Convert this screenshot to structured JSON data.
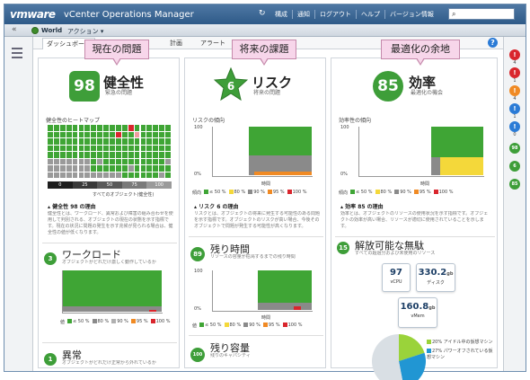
{
  "topbar": {
    "logo": "vmware",
    "app_title": "vCenter Operations Manager",
    "nav": [
      "構成",
      "通知",
      "ログアウト",
      "ヘルプ",
      "バージョン情報"
    ],
    "search_icon": "search-icon"
  },
  "toolbar": {
    "world": "World",
    "actions": "アクション",
    "dbl": "«"
  },
  "tabs": [
    "ダッシュボード",
    "計画",
    "アラート"
  ],
  "callouts": [
    "現在の問題",
    "将来の課題",
    "最適化の余地"
  ],
  "health": {
    "score": "98",
    "title": "健全性",
    "subtitle": "緊急の問題",
    "heatmap_label": "健全性のヒートマップ",
    "scale": [
      "0",
      "25",
      "50",
      "75",
      "100"
    ],
    "scale_caption": "すべてのオブジェクト(健全性)",
    "reason_title": "健全性 98 の理由",
    "reason_desc": "健全性とは、ワークロード、異常および障害の組み合わせを使用して判別される、オブジェクトの現在の状態を示す指標です。現在の状況に問題の発生を示す兆候が見られる場合は、健全性の値が低くなります。"
  },
  "workload": {
    "title": "ワークロード",
    "desc": "オブジェクトがどれだけ激しく動作しているか",
    "legend": [
      "≤ 50 %",
      "80 %",
      "90 %",
      "95 %",
      "100 %"
    ],
    "legend_prefix": "値"
  },
  "anomaly": {
    "title": "異常",
    "desc": "オブジェクトがどれだけ正常から外れているか"
  },
  "risk": {
    "score": "6",
    "title": "リスク",
    "subtitle": "将来の問題",
    "trend_label": "リスクの傾向",
    "y_top": "100",
    "y_bottom": "0%",
    "x_labels": [
      "",
      "時間",
      ""
    ],
    "legend": [
      "≤ 50 %",
      "80 %",
      "90 %",
      "95 %",
      "100 %"
    ],
    "legend_prefix": "傾向",
    "reason_title": "リスク 6 の理由",
    "reason_desc": "リスクとは、オブジェクトの将来に発生する可能性のある問題を示す指標です。オブジェクトのリスクが高い場合、今後そのオブジェクトで問題が発生する可能性が高くなります。"
  },
  "time_remaining": {
    "score": "89",
    "title": "残り時間",
    "desc": "リソースの容量が枯渇するまでの残り時間",
    "legend": [
      "≤ 50 %",
      "80 %",
      "90 %",
      "95 %",
      "100 %"
    ],
    "legend_prefix": "値",
    "x_labels": [
      "",
      "時間",
      ""
    ],
    "y_top": "100",
    "y_bottom": "0%"
  },
  "capacity_remaining": {
    "score": "100",
    "title": "残り容量",
    "desc": "残りのキャパシティ"
  },
  "efficiency": {
    "score": "85",
    "title": "効率",
    "subtitle": "最適化の機会",
    "trend_label": "効率性の傾向",
    "y_top": "100",
    "y_bottom": "0%",
    "x_labels": [
      "",
      "時間",
      ""
    ],
    "legend": [
      "≤ 50 %",
      "80 %",
      "90 %",
      "95 %",
      "100 %"
    ],
    "legend_prefix": "傾向",
    "reason_title": "効率 85 の理由",
    "reason_desc": "効率とは、オブジェクトのリソースの使用状況を示す指標です。オブジェクトの効率が高い場合、リソースが適切に使用されていることを示します。"
  },
  "reclaimable": {
    "score": "15",
    "title": "解放可能な無駄",
    "desc": "すべての超過分および未使用のリソース",
    "tiles": [
      {
        "value": "97",
        "unit": "",
        "caption": "vCPU"
      },
      {
        "value": "330.2",
        "unit": "gb",
        "caption": "ディスク"
      },
      {
        "value": "160.8",
        "unit": "gb",
        "caption": "vMem"
      }
    ],
    "pie_legend": [
      "20% アイドル中の仮想マシン",
      "27% パワーオフされている仮想マシン"
    ],
    "pie_slices": [
      20,
      27,
      53
    ]
  },
  "right_rail": {
    "badges": [
      {
        "kind": "alert",
        "count": "4"
      },
      {
        "kind": "alert",
        "count": "1"
      },
      {
        "kind": "warn",
        "count": "4"
      },
      {
        "kind": "info",
        "count": "1"
      },
      {
        "kind": "info",
        "count": "0"
      }
    ],
    "mini_scores": [
      "98",
      "6",
      "85"
    ]
  },
  "colors": {
    "green": "#3fa535",
    "dark_gray": "#6f6f6f",
    "gray": "#9a9a9a",
    "yellow": "#f4d83a",
    "orange": "#f08a24",
    "red": "#d9262d",
    "pink": "#f7d6ea"
  }
}
